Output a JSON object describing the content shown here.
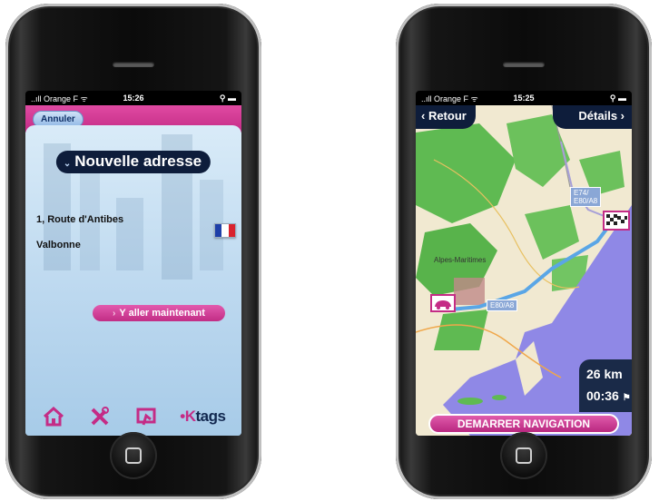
{
  "left_phone": {
    "status": {
      "carrier": "..ıll Orange F  ᯤ",
      "time": "15:26",
      "battery": "⚲ ▬"
    },
    "cancel_label": "Annuler",
    "title": "Nouvelle adresse",
    "address_line1": "1, Route d'Antibes",
    "address_line2": "Valbonne",
    "go_button": "Y aller maintenant",
    "brand": {
      "dot": "•",
      "k": "K",
      "rest": "tags"
    },
    "icons": [
      "home-icon",
      "tools-icon",
      "share-icon"
    ]
  },
  "right_phone": {
    "status": {
      "carrier": "..ıll Orange F  ᯤ",
      "time": "15:25",
      "battery": "⚲ ▬"
    },
    "back_label": "‹ Retour",
    "details_label": "Détails  ›",
    "route_labels": {
      "top": "E74/\nE80/A8",
      "bottom": "E80/A8"
    },
    "region": "Alpes-Maritimes",
    "distance": "26 km",
    "duration": "00:36",
    "start_button": "DEMARRER NAVIGATION"
  },
  "colors": {
    "accent_pink": "#c42c86",
    "navy": "#0e1d3b",
    "sea": "#8f88e6",
    "forest": "#54b34a"
  }
}
